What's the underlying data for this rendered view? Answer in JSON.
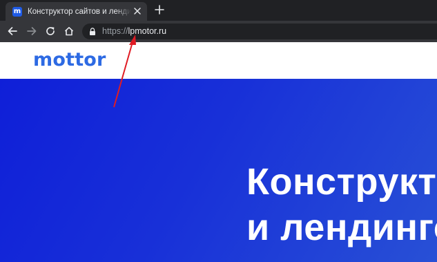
{
  "browser": {
    "tab": {
      "favicon_letter": "m",
      "title": "Конструктор сайтов и лендингов"
    },
    "address": {
      "scheme": "https://",
      "host": "lpmotor.ru"
    },
    "icons": [
      "close-icon",
      "new-tab-icon",
      "back-icon",
      "forward-icon",
      "reload-icon",
      "home-icon",
      "lock-icon"
    ]
  },
  "page": {
    "logo": "mottor",
    "hero": {
      "line1": "Конструктор",
      "line2": "и лендингов"
    }
  },
  "colors": {
    "brand": "#2d6ae3",
    "hero_start": "#0f1fd8",
    "hero_end": "#2850d6",
    "annotation_arrow": "#e01b24"
  }
}
